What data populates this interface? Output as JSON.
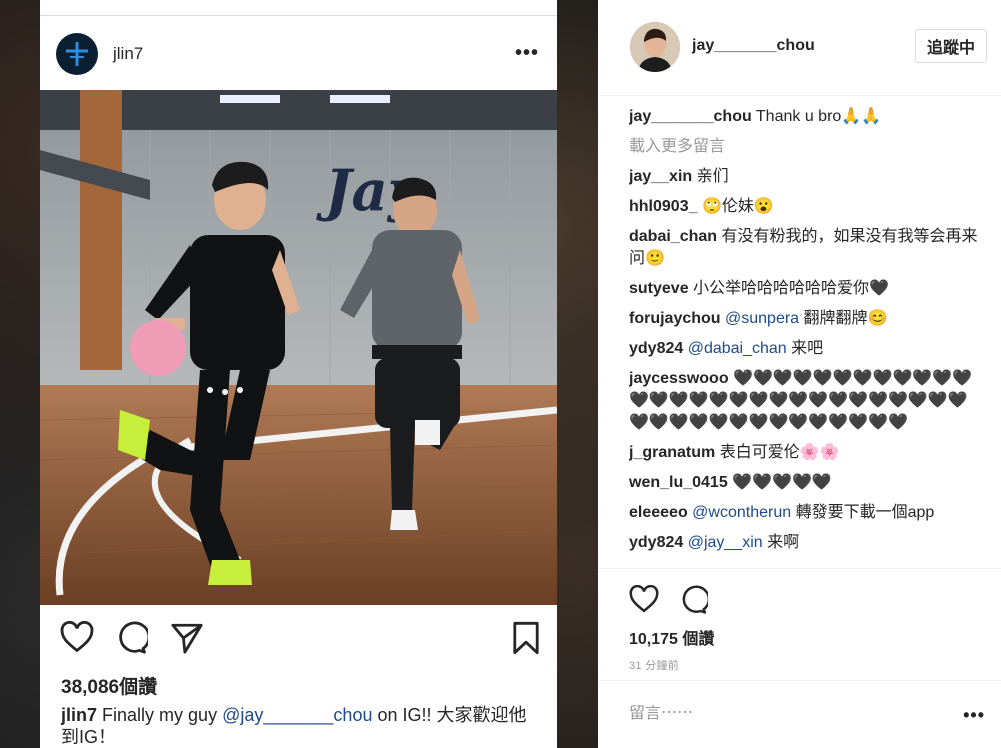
{
  "phone_post": {
    "username": "jlin7",
    "photo_logo_text": "Jay",
    "likes": "38,086個讚",
    "caption": {
      "user": "jlin7",
      "text_before": "Finally my guy ",
      "mention": "@jay_______chou",
      "text_after": " on IG!! 大家歡迎他到IG！"
    }
  },
  "sidebar": {
    "username": "jay_______chou",
    "follow_label": "追蹤中",
    "load_more": "載入更多留言",
    "comments": [
      {
        "user": "jay_______chou",
        "text": "Thank u bro🙏🙏"
      },
      {
        "user": "jay__xin",
        "text": "亲们"
      },
      {
        "user": "hhl0903_",
        "text": "🙄伦妹😮"
      },
      {
        "user": "dabai_chan",
        "text": "有没有粉我的，如果没有我等会再来问🙂"
      },
      {
        "user": "sutyeve",
        "text": "小公举哈哈哈哈哈哈爱你🖤"
      },
      {
        "user": "forujaychou",
        "mention": "@sunpera",
        "text": "翻牌翻牌😊"
      },
      {
        "user": "ydy824",
        "mention": "@dabai_chan",
        "text": "来吧"
      },
      {
        "user": "jaycesswooo",
        "text": "🖤🖤🖤🖤🖤🖤🖤🖤🖤🖤🖤🖤🖤🖤🖤🖤🖤🖤🖤🖤🖤🖤🖤🖤🖤🖤🖤🖤🖤🖤🖤🖤🖤🖤🖤🖤🖤🖤🖤🖤🖤🖤🖤"
      },
      {
        "user": "j_granatum",
        "text": "表白可爱伦🌸🌸"
      },
      {
        "user": "wen_lu_0415",
        "text": "🖤🖤🖤🖤🖤"
      },
      {
        "user": "eleeeeo",
        "mention": "@wcontherun",
        "text": "轉發要下載一個app"
      },
      {
        "user": "ydy824",
        "mention": "@jay__xin",
        "text": "来啊"
      }
    ],
    "likes": "10,175 個讚",
    "timestamp": "31 分鐘前",
    "comment_placeholder": "留言⋯⋯"
  },
  "icons": {
    "more": "ellipsis-icon",
    "like": "heart-icon",
    "comment": "comment-icon",
    "share": "send-icon",
    "save": "bookmark-icon"
  },
  "colors": {
    "text": "#262626",
    "secondary": "#999999",
    "link": "#1e4b8b",
    "border": "#dbdbdb"
  }
}
